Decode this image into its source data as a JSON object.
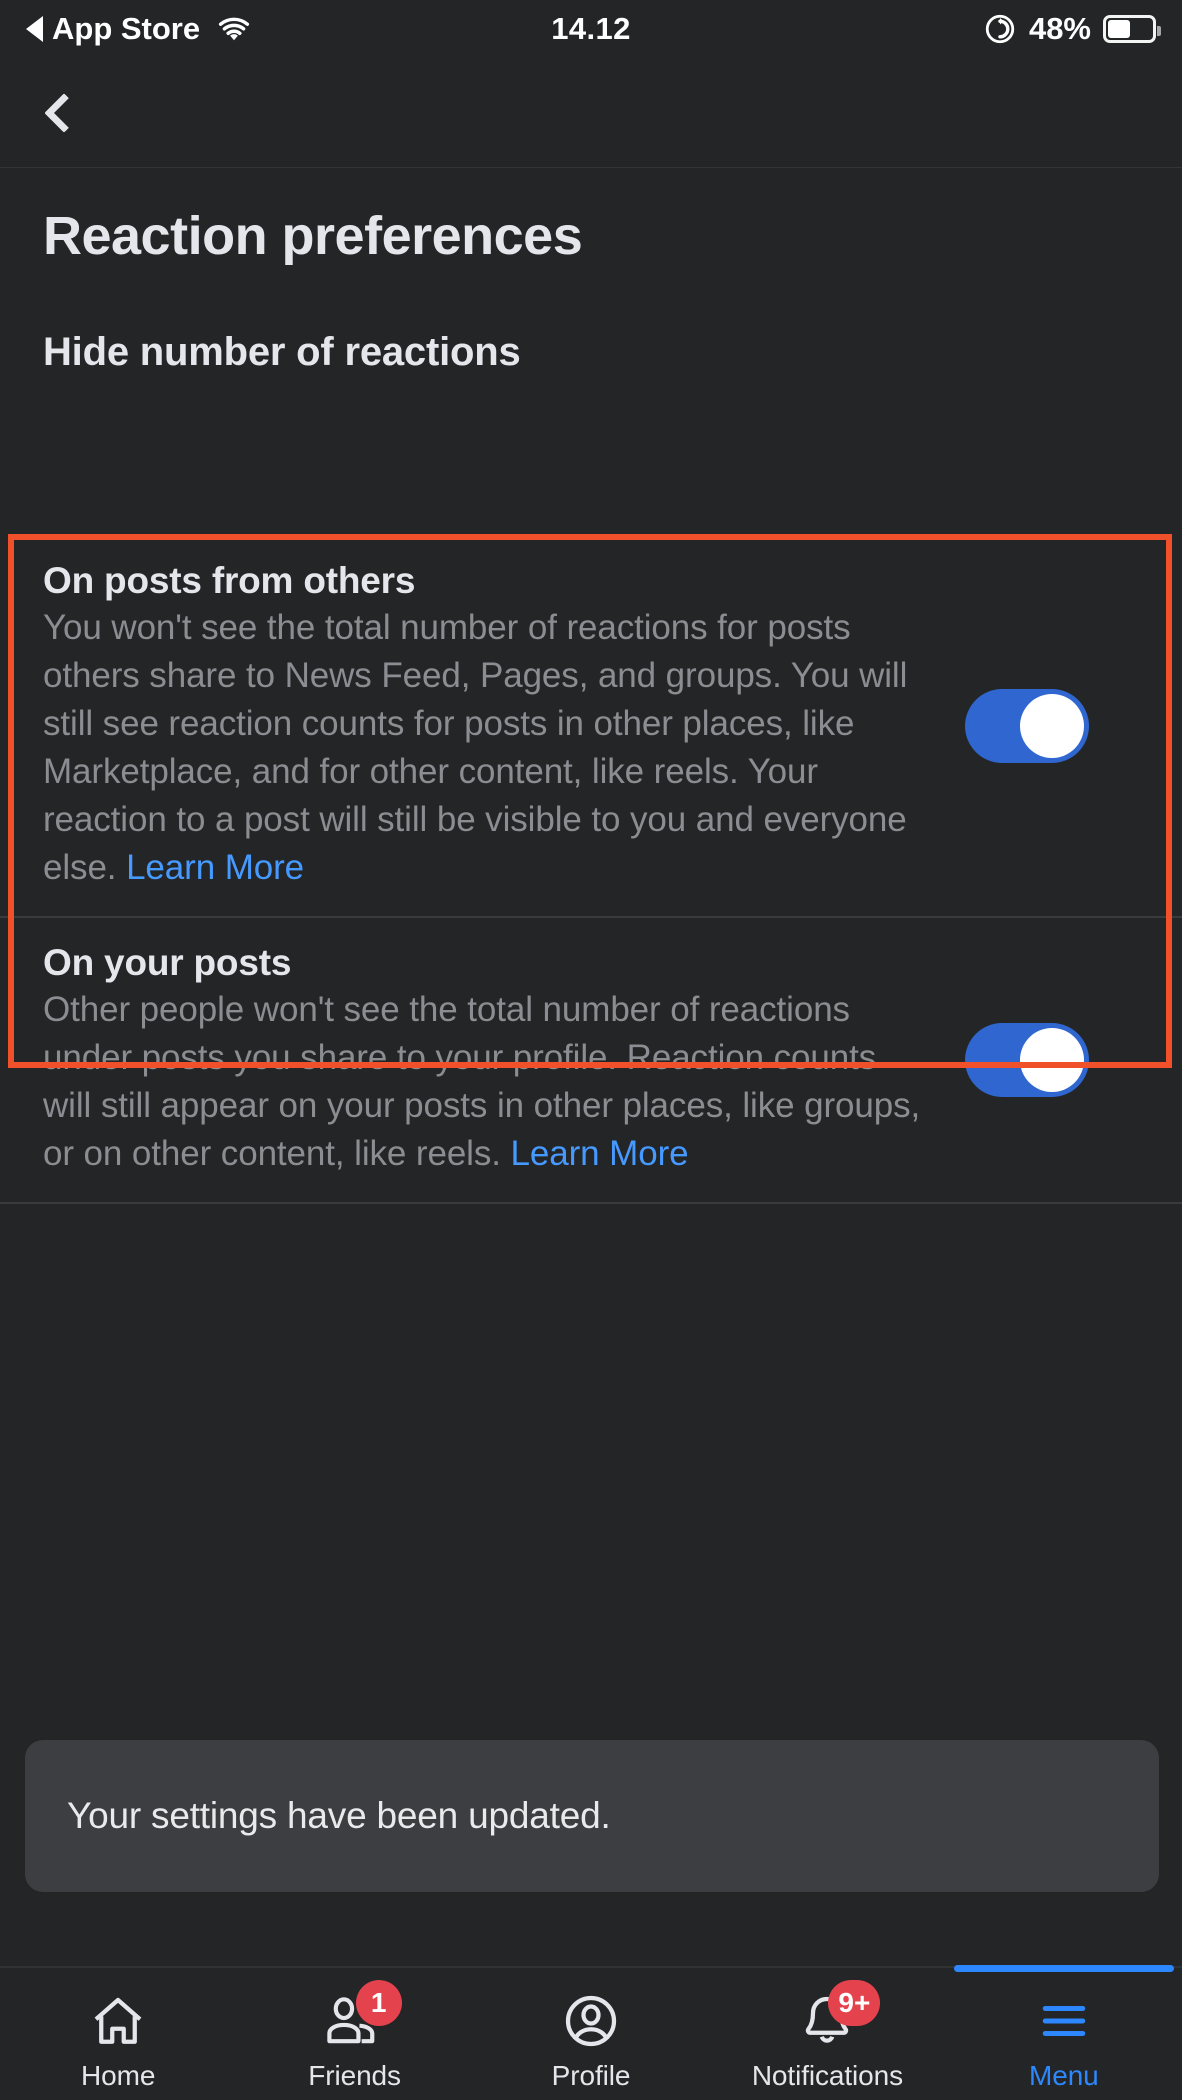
{
  "status_bar": {
    "back_app": "App Store",
    "wifi_icon": "wifi-icon",
    "time": "14.12",
    "orientation_lock_icon": "rotation-lock-icon",
    "battery_percent": "48%",
    "battery_icon": "battery-icon"
  },
  "header": {
    "back_icon": "chevron-left-icon"
  },
  "page": {
    "title": "Reaction preferences",
    "section_title": "Hide number of reactions"
  },
  "settings": [
    {
      "title": "On posts from others",
      "description": "You won't see the total number of reactions for posts others share to News Feed, Pages, and groups. You will still see reaction counts for posts in other places, like Marketplace, and for other content, like reels. Your reaction to a post will still be visible to you and everyone else. ",
      "link_label": "Learn More",
      "toggle_state": "on"
    },
    {
      "title": "On your posts",
      "description": "Other people won't see the total number of reactions under posts you share to your profile. Reaction counts will still appear on your posts in other places, like groups, or on other content, like reels. ",
      "link_label": "Learn More",
      "toggle_state": "on"
    }
  ],
  "toast": {
    "message": "Your settings have been updated."
  },
  "bottom_nav": [
    {
      "label": "Home",
      "icon": "home-icon",
      "badge": "",
      "active": false
    },
    {
      "label": "Friends",
      "icon": "friends-icon",
      "badge": "1",
      "active": false
    },
    {
      "label": "Profile",
      "icon": "profile-icon",
      "badge": "",
      "active": false
    },
    {
      "label": "Notifications",
      "icon": "bell-icon",
      "badge": "9+",
      "active": false
    },
    {
      "label": "Menu",
      "icon": "hamburger-menu-icon",
      "badge": "",
      "active": true
    }
  ],
  "colors": {
    "background": "#242526",
    "toggle_on": "#2f66d0",
    "link_blue": "#4599ff",
    "accent_blue": "#2d88ff",
    "badge_red": "#e4434e",
    "annotation_red": "#f0502a",
    "toast_background": "#3c3e41",
    "muted_text": "#8a8d91"
  }
}
